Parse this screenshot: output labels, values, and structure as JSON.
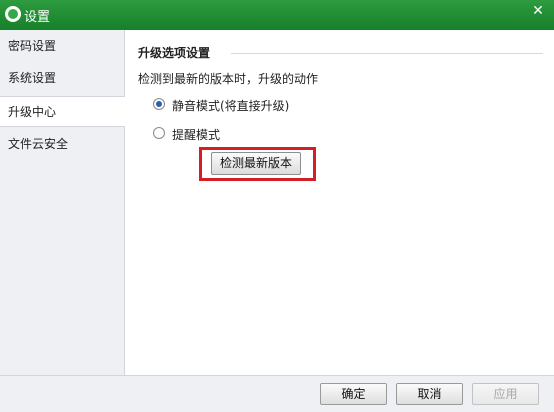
{
  "window": {
    "title": "设置",
    "close_glyph": "✕"
  },
  "sidebar": {
    "items": [
      {
        "label": "密码设置",
        "active": false
      },
      {
        "label": "系统设置",
        "active": false
      },
      {
        "label": "升级中心",
        "active": true
      },
      {
        "label": "文件云安全",
        "active": false
      }
    ]
  },
  "main": {
    "section_title": "升级选项设置",
    "description": "检测到最新的版本时，升级的动作",
    "options": [
      {
        "label": "静音模式(将直接升级)",
        "checked": true
      },
      {
        "label": "提醒模式",
        "checked": false
      }
    ],
    "check_button_label": "检测最新版本",
    "highlight_color": "#d21e25"
  },
  "footer": {
    "ok_label": "确定",
    "cancel_label": "取消",
    "apply_label": "应用",
    "apply_enabled": false
  },
  "colors": {
    "titlebar": "#16802a",
    "sidebar_bg": "#eef0f3"
  }
}
